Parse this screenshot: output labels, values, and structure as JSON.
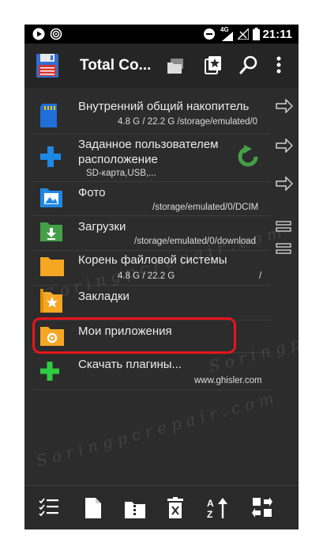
{
  "status_bar": {
    "time": "21:11",
    "network": "4G"
  },
  "toolbar": {
    "title": "Total Co...",
    "icons": [
      "floppy-disk-icon",
      "folders-icon",
      "bookmarks-icon",
      "search-icon",
      "overflow-menu-icon"
    ]
  },
  "items": [
    {
      "title": "Внутренний общий накопитель",
      "subtitle": "4.8 G / 22.2 G   /storage/emulated/0",
      "icon": "sd-card-icon"
    },
    {
      "title": "Заданное пользователем",
      "title2": "расположение",
      "subtitle": "SD-карта,USB,...",
      "icon": "plus-icon"
    },
    {
      "title": "Фото",
      "subtitle": "/storage/emulated/0/DCIM",
      "icon": "photo-folder-icon"
    },
    {
      "title": "Загрузки",
      "subtitle": "/storage/emulated/0/download",
      "icon": "downloads-folder-icon"
    },
    {
      "title": "Корень файловой системы",
      "subtitle": "4.8 G / 22.2 G",
      "subtitle_right": "/",
      "icon": "root-folder-icon"
    },
    {
      "title": "Закладки",
      "icon": "bookmarks-folder-icon"
    },
    {
      "title": "Мои приложения",
      "icon": "apps-folder-icon"
    },
    {
      "title": "Скачать плагины...",
      "subtitle": "www.ghisler.com",
      "icon": "add-plugin-icon"
    }
  ],
  "bottom_bar": {
    "icons": [
      "select-list-icon",
      "new-file-icon",
      "archive-icon",
      "delete-icon",
      "sort-icon",
      "swap-panels-icon"
    ]
  },
  "colors": {
    "background": "#2c2c2c",
    "highlight": "#e8141b",
    "folder_yellow": "#f5a623",
    "refresh_green": "#4caf50"
  }
}
